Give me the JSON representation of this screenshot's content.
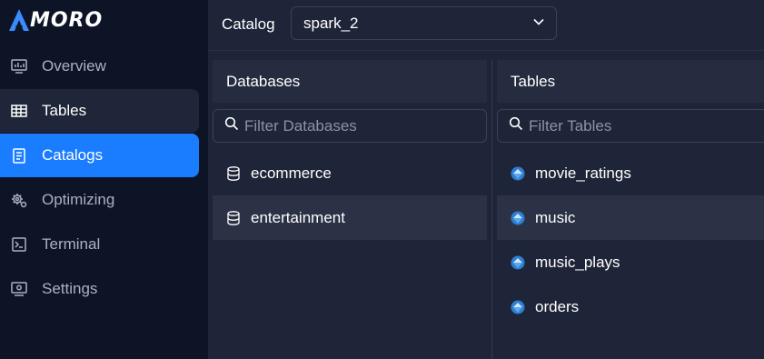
{
  "app": {
    "logo_text": "MORO"
  },
  "sidebar": {
    "items": [
      {
        "label": "Overview",
        "icon": "overview-icon"
      },
      {
        "label": "Tables",
        "icon": "table-icon"
      },
      {
        "label": "Catalogs",
        "icon": "catalog-icon"
      },
      {
        "label": "Optimizing",
        "icon": "optimizing-icon"
      },
      {
        "label": "Terminal",
        "icon": "terminal-icon"
      },
      {
        "label": "Settings",
        "icon": "settings-icon"
      }
    ],
    "active": "Catalogs",
    "hovered": "Tables"
  },
  "topbar": {
    "catalog_label": "Catalog",
    "catalog_value": "spark_2"
  },
  "databases": {
    "header": "Databases",
    "filter_placeholder": "Filter Databases",
    "items": [
      "ecommerce",
      "entertainment"
    ],
    "selected": "entertainment"
  },
  "tables": {
    "header": "Tables",
    "filter_placeholder": "Filter Tables",
    "items": [
      "movie_ratings",
      "music",
      "music_plays",
      "orders"
    ],
    "selected": "music"
  },
  "colors": {
    "accent": "#1a7dff",
    "sidebar_bg": "#0d1426",
    "main_bg": "#1f2538"
  }
}
